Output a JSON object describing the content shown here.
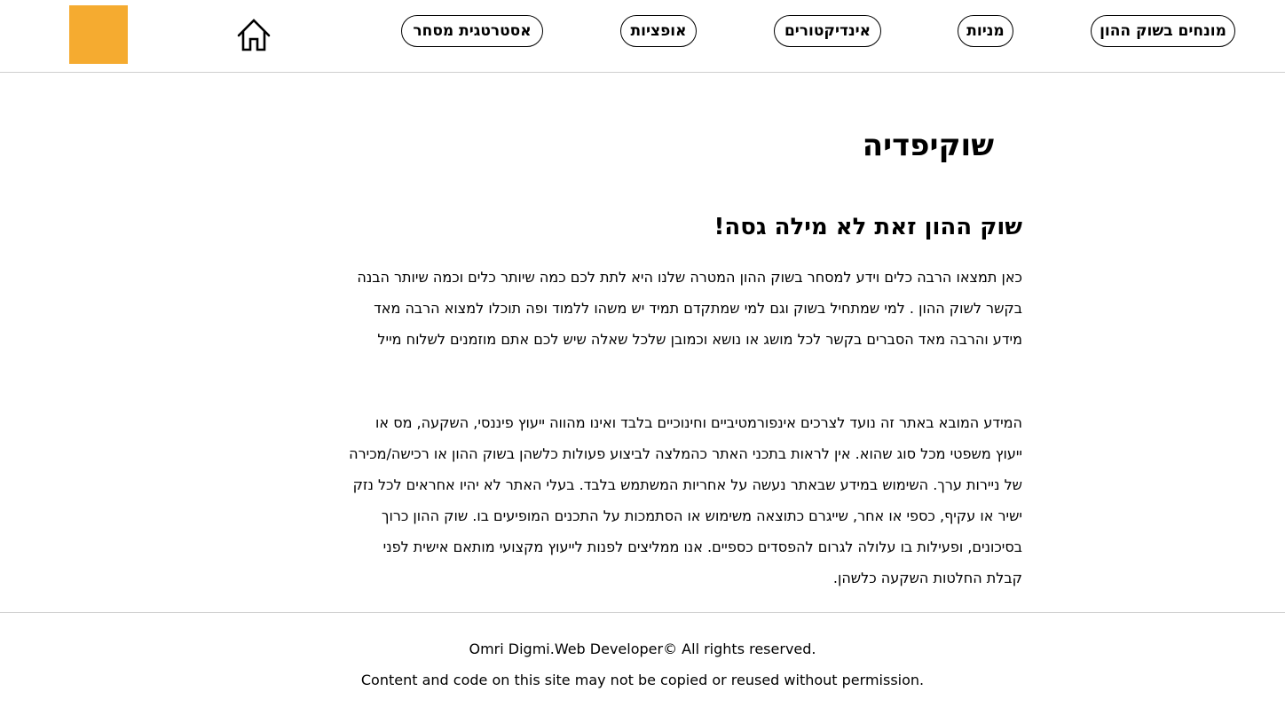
{
  "header": {
    "logo": {
      "color": "#f5ab30"
    },
    "home_icon": "home-icon",
    "nav": [
      {
        "label": "מונחים בשוק ההון"
      },
      {
        "label": "מניות"
      },
      {
        "label": "אינדיקטורים"
      },
      {
        "label": "אופציות"
      },
      {
        "label": "אסטרטגית מסחר"
      }
    ]
  },
  "main": {
    "page_title": "שוקיפדיה",
    "section_heading": "שוק ההון זאת לא מילה גסה!",
    "paragraphs": [
      "כאן תמצאו הרבה כלים וידע למסחר בשוק ההון המטרה שלנו היא לתת לכם כמה שיותר כלים וכמה שיותר הבנה בקשר לשוק ההון . למי שמתחיל בשוק וגם למי שמתקדם תמיד יש משהו ללמוד ופה תוכלו למצוא הרבה מאד מידע והרבה מאד הסברים בקשר לכל מושג או נושא וכמובן שלכל שאלה שיש לכם אתם מוזמנים לשלוח מייל",
      "המידע המובא באתר זה נועד לצרכים אינפורמטיביים וחינוכיים בלבד ואינו מהווה ייעוץ פיננסי, השקעה, מס או ייעוץ משפטי מכל סוג שהוא. אין לראות בתכני האתר כהמלצה לביצוע פעולות כלשהן בשוק ההון או רכישה/מכירה של ניירות ערך. השימוש במידע שבאתר נעשה על אחריות המשתמש בלבד. בעלי האתר לא יהיו אחראים לכל נזק ישיר או עקיף, כספי או אחר, שייגרם כתוצאה משימוש או הסתמכות על התכנים המופיעים בו. שוק ההון כרוך בסיכונים, ופעילות בו עלולה לגרום להפסדים כספיים. אנו ממליצים לפנות לייעוץ מקצועי מותאם אישית לפני קבלת החלטות השקעה כלשהן."
    ]
  },
  "footer": {
    "copyright": "Omri Digmi.Web Developer© All rights reserved.",
    "notice": "Content and code on this site may not be copied or reused without permission."
  }
}
